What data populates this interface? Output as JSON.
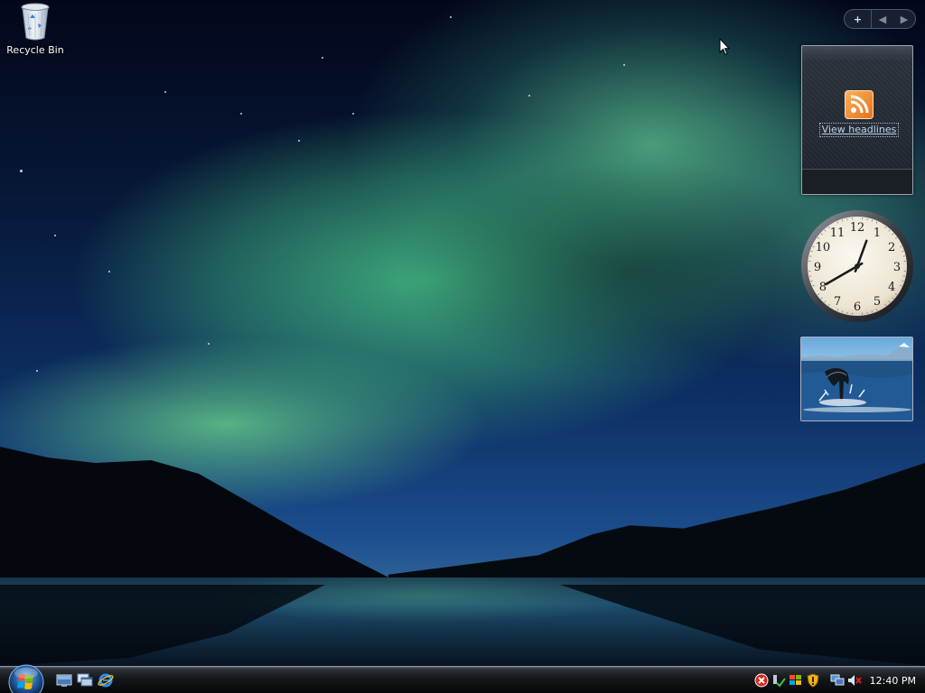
{
  "desktop": {
    "icons": [
      {
        "label": "Recycle Bin",
        "icon": "recycle-bin-icon"
      }
    ]
  },
  "sidebar": {
    "controls": {
      "add_label": "+",
      "prev_label": "◀",
      "next_label": "▶"
    },
    "feed_gadget": {
      "link_text": "View headlines",
      "icon": "rss-feed-icon"
    },
    "clock_gadget": {
      "numerals": [
        "12",
        "1",
        "2",
        "3",
        "4",
        "5",
        "6",
        "7",
        "8",
        "9",
        "10",
        "11"
      ],
      "hour": 12,
      "minute": 40
    },
    "slideshow_gadget": {
      "icon": "whale-tail-photo"
    }
  },
  "taskbar": {
    "start_icon": "windows-orb-icon",
    "quick_launch": [
      "show-desktop-icon",
      "switch-windows-icon",
      "internet-explorer-icon"
    ],
    "tray_icons": [
      "security-alert-icon",
      "network-status-icon",
      "windows-update-icon",
      "network-icon",
      "volume-muted-icon"
    ],
    "clock": "12:40 PM"
  }
}
